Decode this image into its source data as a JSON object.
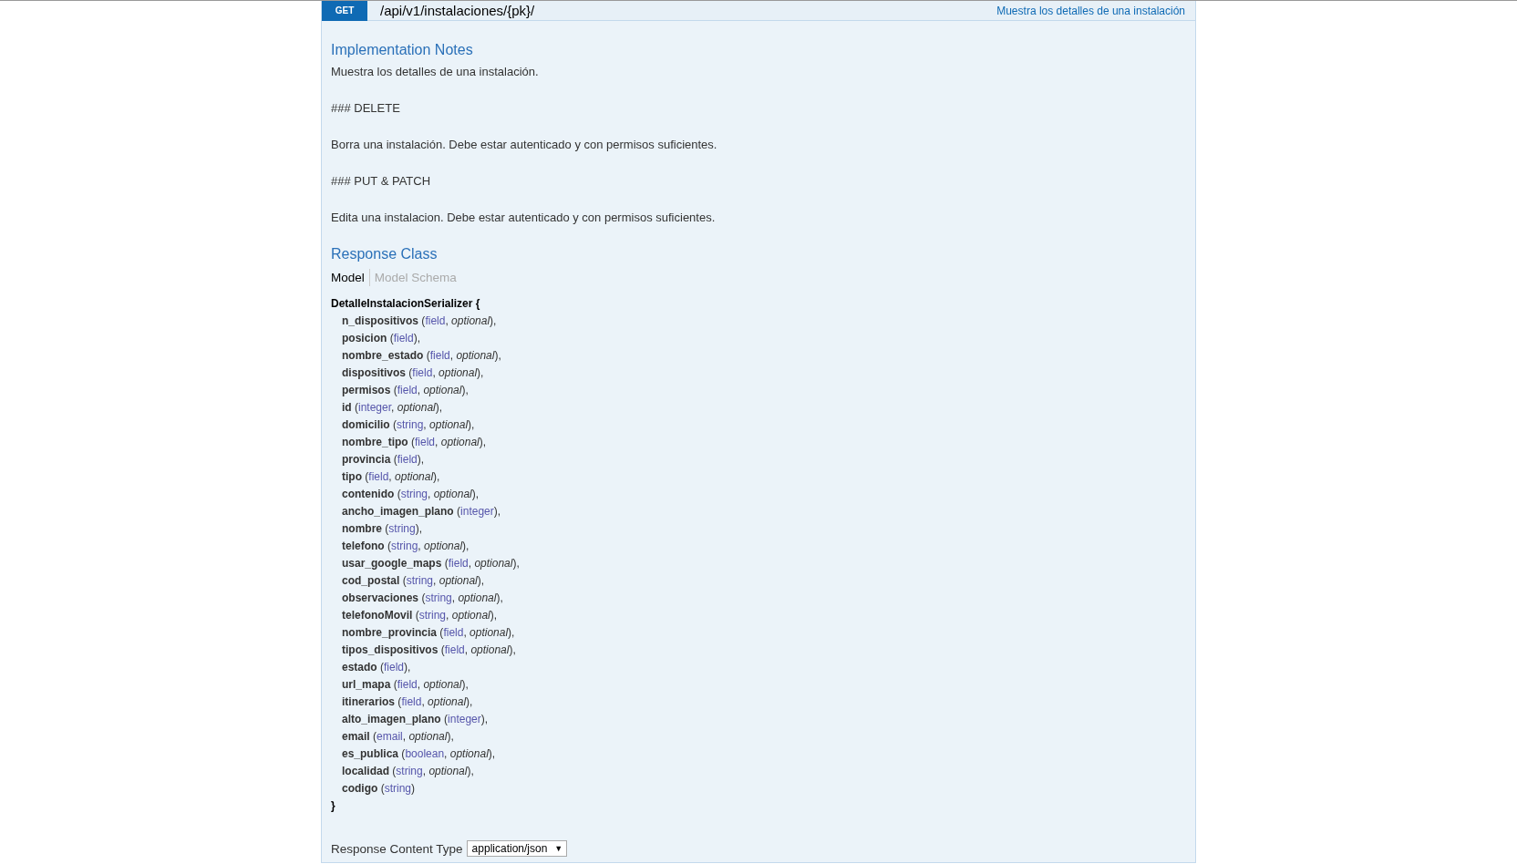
{
  "operation": {
    "method": "GET",
    "path": "/api/v1/instalaciones/{pk}/",
    "summary": "Muestra los detalles de una instalación"
  },
  "implementation_notes": {
    "title": "Implementation Notes",
    "paragraphs": [
      "Muestra los detalles de una instalación.",
      "### DELETE",
      "Borra una instalación. Debe estar autenticado y con permisos suficientes.",
      "### PUT & PATCH",
      "Edita una instalacion. Debe estar autenticado y con permisos suficientes."
    ]
  },
  "response_class": {
    "title": "Response Class",
    "tabs": [
      {
        "label": "Model",
        "selected": true
      },
      {
        "label": "Model Schema",
        "selected": false
      }
    ],
    "model_name": "DetalleInstalacionSerializer {",
    "closing": "}",
    "fields": [
      {
        "name": "n_dispositivos",
        "open": "(",
        "type": "field",
        "modifier": ", *optional*",
        "close": "),"
      },
      {
        "name": "posicion",
        "open": "(",
        "type": "field",
        "close": "),"
      },
      {
        "name": "nombre_estado",
        "open": "(",
        "type": "field",
        "modifier": ", *optional*",
        "close": "),"
      },
      {
        "name": "dispositivos",
        "open": "(",
        "type": "field",
        "modifier": ", *optional*",
        "close": "),"
      },
      {
        "name": "permisos",
        "open": "(",
        "type": "field",
        "modifier": ", *optional*",
        "close": "),"
      },
      {
        "name": "id",
        "open": "(",
        "type": "integer",
        "modifier": ", *optional*",
        "close": "),"
      },
      {
        "name": "domicilio",
        "open": "(",
        "type": "string",
        "modifier": ", *optional*",
        "close": "),"
      },
      {
        "name": "nombre_tipo",
        "open": "(",
        "type": "field",
        "modifier": ", *optional*",
        "close": "),"
      },
      {
        "name": "provincia",
        "open": "(",
        "type": "field",
        "close": "),"
      },
      {
        "name": "tipo",
        "open": "(",
        "type": "field",
        "modifier": ", *optional*",
        "close": "),"
      },
      {
        "name": "contenido",
        "open": "(",
        "type": "string",
        "modifier": ", *optional*",
        "close": "),"
      },
      {
        "name": "ancho_imagen_plano",
        "open": "(",
        "type": "integer",
        "close": "),"
      },
      {
        "name": "nombre",
        "open": "(",
        "type": "string",
        "close": "),"
      },
      {
        "name": "telefono",
        "open": "(",
        "type": "string",
        "modifier": ", *optional*",
        "close": "),"
      },
      {
        "name": "usar_google_maps",
        "open": "(",
        "type": "field",
        "modifier": ", *optional*",
        "close": "),"
      },
      {
        "name": "cod_postal",
        "open": "(",
        "type": "string",
        "modifier": ", *optional*",
        "close": "),"
      },
      {
        "name": "observaciones",
        "open": "(",
        "type": "string",
        "modifier": ", *optional*",
        "close": "),"
      },
      {
        "name": "telefonoMovil",
        "open": "(",
        "type": "string",
        "modifier": ", *optional*",
        "close": "),"
      },
      {
        "name": "nombre_provincia",
        "open": "(",
        "type": "field",
        "modifier": ", *optional*",
        "close": "),"
      },
      {
        "name": "tipos_dispositivos",
        "open": "(",
        "type": "field",
        "modifier": ", *optional*",
        "close": "),"
      },
      {
        "name": "estado",
        "open": "(",
        "type": "field",
        "close": "),"
      },
      {
        "name": "url_mapa",
        "open": "(",
        "type": "field",
        "modifier": ", *optional*",
        "close": "),"
      },
      {
        "name": "itinerarios",
        "open": "(",
        "type": "field",
        "modifier": ", *optional*",
        "close": "),"
      },
      {
        "name": "alto_imagen_plano",
        "open": "(",
        "type": "integer",
        "close": "),"
      },
      {
        "name": "email",
        "open": "(",
        "type": "email",
        "modifier": ", *optional*",
        "close": "),"
      },
      {
        "name": "es_publica",
        "open": "(",
        "type": "boolean",
        "modifier": ", *optional*",
        "close": "),"
      },
      {
        "name": "localidad",
        "open": "(",
        "type": "string",
        "modifier": ", *optional*",
        "close": "),"
      },
      {
        "name": "codigo",
        "open": "(",
        "type": "string",
        "close": ")"
      }
    ]
  },
  "response_content_type": {
    "label": "Response Content Type",
    "value": "application/json",
    "arrow": "▼"
  }
}
